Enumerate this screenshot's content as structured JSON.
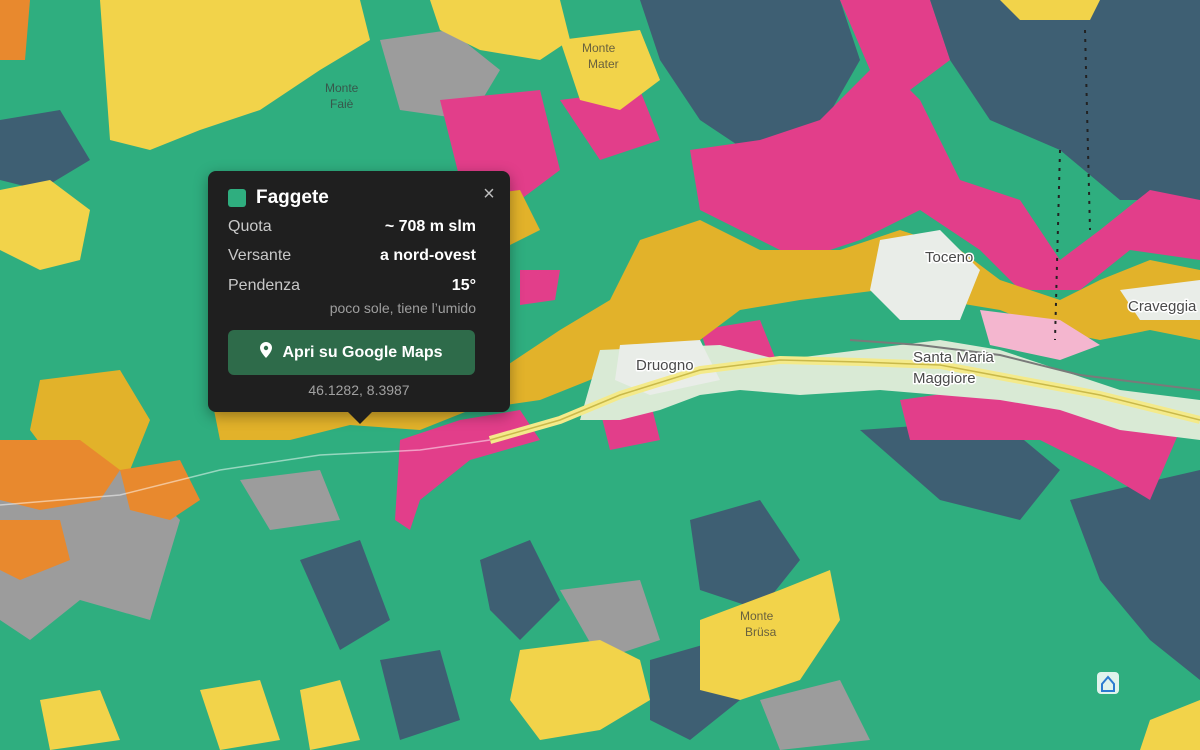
{
  "map": {
    "places": [
      {
        "name": "Druogno"
      },
      {
        "name": "Santa Maria"
      },
      {
        "name": "Maggiore"
      },
      {
        "name": "Toceno"
      },
      {
        "name": "Craveggia"
      }
    ],
    "peaks": [
      "Monte",
      "Mater",
      "Monte",
      "Faiè",
      "Monte",
      "Brüsa"
    ],
    "colors": {
      "faggete": "#2fae7f",
      "conifer": "#3e5f73",
      "larch": "#f2d34a",
      "chestnut": "#e8b62a",
      "pine": "#e23e8a",
      "rock": "#9c9c9c",
      "orange": "#e8892e",
      "urban": "#e9ede8",
      "road": "#f4ea8a"
    }
  },
  "popup": {
    "title": "Faggete",
    "swatch_color": "#2fae7f",
    "close_symbol": "×",
    "rows": [
      {
        "label": "Quota",
        "value": "~ 708 m slm"
      },
      {
        "label": "Versante",
        "value": "a nord-ovest"
      },
      {
        "label": "Pendenza",
        "value": "15°"
      }
    ],
    "note": "poco sole, tiene l’umido",
    "button_label": "Apri su Google Maps",
    "button_icon": "map-pin-icon",
    "coordinates": "46.1282, 8.3987"
  }
}
